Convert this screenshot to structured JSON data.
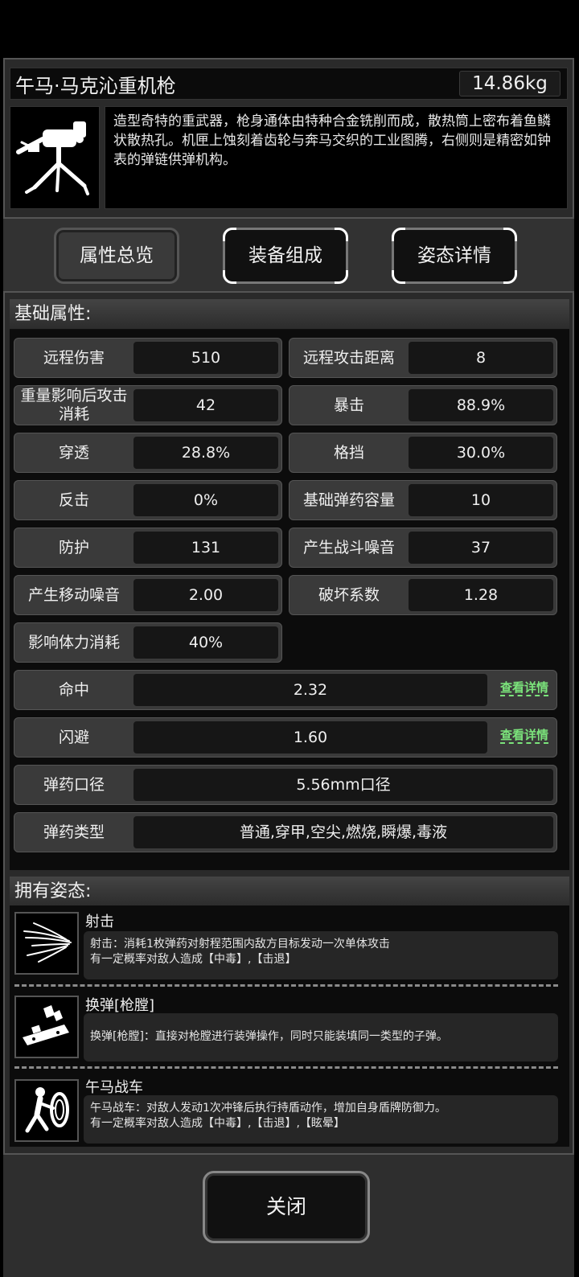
{
  "item": {
    "name": "午马·马克沁重机枪",
    "weight": "14.86kg",
    "description": "造型奇特的重武器，枪身通体由特种合金铣削而成，散热筒上密布着鱼鳞状散热孔。机匣上蚀刻着齿轮与奔马交织的工业图腾，右侧则是精密如钟表的弹链供弹机构。",
    "icon": "heavy-machine-gun-icon"
  },
  "tabs": [
    {
      "label": "属性总览"
    },
    {
      "label": "装备组成"
    },
    {
      "label": "姿态详情"
    }
  ],
  "basic": {
    "header": "基础属性:",
    "stats": [
      {
        "label": "远程伤害",
        "value": "510"
      },
      {
        "label": "远程攻击距离",
        "value": "8"
      },
      {
        "label": "重量影响后攻击消耗",
        "value": "42"
      },
      {
        "label": "暴击",
        "value": "88.9%"
      },
      {
        "label": "穿透",
        "value": "28.8%"
      },
      {
        "label": "格挡",
        "value": "30.0%"
      },
      {
        "label": "反击",
        "value": "0%"
      },
      {
        "label": "基础弹药容量",
        "value": "10"
      },
      {
        "label": "防护",
        "value": "131"
      },
      {
        "label": "产生战斗噪音",
        "value": "37"
      },
      {
        "label": "产生移动噪音",
        "value": "2.00"
      },
      {
        "label": "破坏系数",
        "value": "1.28"
      },
      {
        "label": "影响体力消耗",
        "value": "40%"
      }
    ],
    "wide": [
      {
        "label": "命中",
        "value": "2.32",
        "link": "查看详情"
      },
      {
        "label": "闪避",
        "value": "1.60",
        "link": "查看详情"
      },
      {
        "label": "弹药口径",
        "value": "5.56mm口径"
      },
      {
        "label": "弹药类型",
        "value": "普通,穿甲,空尖,燃烧,瞬爆,毒液"
      }
    ]
  },
  "stances": {
    "header": "拥有姿态:",
    "items": [
      {
        "name": "射击",
        "icon": "shooting-lines-icon",
        "line1": "射击：消耗1枚弹药对射程范围内敌方目标发动一次单体攻击",
        "line2": "有一定概率对敌人造成【中毒】,【击退】"
      },
      {
        "name": "换弹[枪膛]",
        "icon": "reload-chamber-icon",
        "line1": "换弹[枪膛]：直接对枪膛进行装弹操作，同时只能装填同一类型的子弹。",
        "line2": ""
      },
      {
        "name": "午马战车",
        "icon": "shield-charge-icon",
        "line1": "午马战车：对敌人发动1次冲锋后执行持盾动作，增加自身盾牌防御力。",
        "line2": "有一定概率对敌人造成【中毒】,【击退】,【眩晕】"
      }
    ]
  },
  "close_label": "关闭"
}
